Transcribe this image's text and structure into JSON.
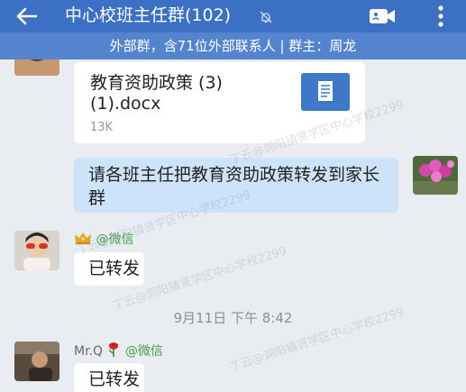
{
  "header": {
    "title": "中心校班主任群(102)",
    "subtitle": "外部群，含71位外部联系人 | 群主：周龙"
  },
  "messages": {
    "file": {
      "name": "教育资助政策 (3) (1).docx",
      "size": "13K"
    },
    "outgoing": {
      "text": "请各班主任把教育资助政策转发到家长群"
    },
    "reply1": {
      "source": "@微信",
      "text": "已转发"
    },
    "timestamp": "9月11日  下午 8:42",
    "reply2": {
      "sender": "Mr.Q",
      "source": "@微信",
      "text": "已转发"
    }
  },
  "watermark": {
    "text1": "丁云@洞阳镇贤学区中心学校2299",
    "text2": "丁云@洞阳镇贤学区中心学校2299",
    "text3": "丁云@洞阳镇贤学区中心学校2299",
    "text4": "丁云@洞阳镇贤学区中心学校2299"
  },
  "icons": {
    "back": "arrow-left-icon",
    "mute": "bell-off-icon",
    "video": "video-call-icon",
    "more": "more-vertical-icon",
    "file": "document-icon",
    "crown": "crown-icon",
    "rose": "rose-icon"
  },
  "colors": {
    "topbar": "#3b70c4",
    "subbar": "#5584cf",
    "chat_background": "#e9edf2",
    "outgoing_bubble": "#cde3f9",
    "wechat_green": "#43a047"
  }
}
